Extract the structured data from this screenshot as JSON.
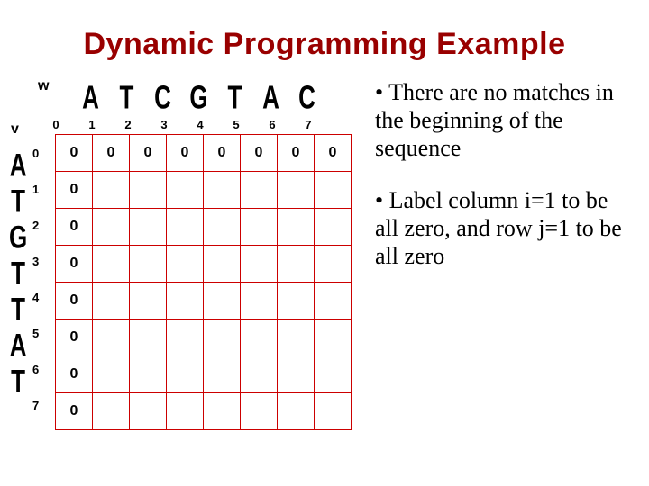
{
  "title": "Dynamic Programming Example",
  "w_label": "w",
  "v_label": "v",
  "col_seq": [
    "A",
    "T",
    "C",
    "G",
    "T",
    "A",
    "C"
  ],
  "row_seq": [
    "A",
    "T",
    "G",
    "T",
    "T",
    "A",
    "T"
  ],
  "col_idx": [
    "0",
    "1",
    "2",
    "3",
    "4",
    "5",
    "6",
    "7"
  ],
  "row_idx": [
    "0",
    "1",
    "2",
    "3",
    "4",
    "5",
    "6",
    "7"
  ],
  "cells": [
    [
      "0",
      "0",
      "0",
      "0",
      "0",
      "0",
      "0",
      "0"
    ],
    [
      "0",
      "",
      "",
      "",
      "",
      "",
      "",
      ""
    ],
    [
      "0",
      "",
      "",
      "",
      "",
      "",
      "",
      ""
    ],
    [
      "0",
      "",
      "",
      "",
      "",
      "",
      "",
      ""
    ],
    [
      "0",
      "",
      "",
      "",
      "",
      "",
      "",
      ""
    ],
    [
      "0",
      "",
      "",
      "",
      "",
      "",
      "",
      ""
    ],
    [
      "0",
      "",
      "",
      "",
      "",
      "",
      "",
      ""
    ],
    [
      "0",
      "",
      "",
      "",
      "",
      "",
      "",
      ""
    ]
  ],
  "bullets": {
    "b1": "•  There are no matches in the beginning of the sequence",
    "b2": "•  Label column i=1 to be all zero, and row j=1 to be all zero"
  },
  "chart_data": {
    "type": "table",
    "title": "Dynamic Programming Example",
    "w_sequence": "ATCGTAC",
    "v_sequence": "ATGTTAT",
    "col_indices": [
      0,
      1,
      2,
      3,
      4,
      5,
      6,
      7
    ],
    "row_indices": [
      0,
      1,
      2,
      3,
      4,
      5,
      6,
      7
    ],
    "matrix": [
      [
        0,
        0,
        0,
        0,
        0,
        0,
        0,
        0
      ],
      [
        0,
        null,
        null,
        null,
        null,
        null,
        null,
        null
      ],
      [
        0,
        null,
        null,
        null,
        null,
        null,
        null,
        null
      ],
      [
        0,
        null,
        null,
        null,
        null,
        null,
        null,
        null
      ],
      [
        0,
        null,
        null,
        null,
        null,
        null,
        null,
        null
      ],
      [
        0,
        null,
        null,
        null,
        null,
        null,
        null,
        null
      ],
      [
        0,
        null,
        null,
        null,
        null,
        null,
        null,
        null
      ],
      [
        0,
        null,
        null,
        null,
        null,
        null,
        null,
        null
      ]
    ]
  }
}
